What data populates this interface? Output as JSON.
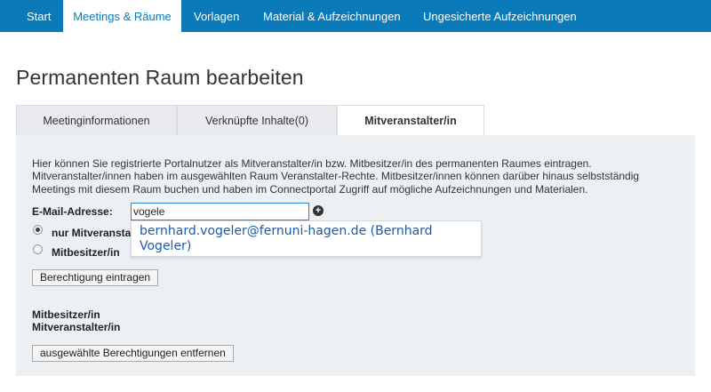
{
  "nav": {
    "items": [
      {
        "label": "Start",
        "active": false
      },
      {
        "label": "Meetings & Räume",
        "active": true
      },
      {
        "label": "Vorlagen",
        "active": false
      },
      {
        "label": "Material & Aufzeichnungen",
        "active": false
      },
      {
        "label": "Ungesicherte Aufzeichnungen",
        "active": false
      }
    ],
    "color": "#0a7ab8"
  },
  "page": {
    "title": "Permanenten Raum bearbeiten"
  },
  "tabs": [
    {
      "label": "Meetinginformationen",
      "active": false
    },
    {
      "label": "Verknüpfte Inhalte(0)",
      "active": false
    },
    {
      "label": "Mitveranstalter/in",
      "active": true
    }
  ],
  "content": {
    "description": "Hier können Sie registrierte Portalnutzer als Mitveranstalter/in bzw. Mitbesitzer/in des permanenten Raumes eintragen. Mitveranstalter/innen haben im ausgewählten Raum Veranstalter-Rechte. Mitbesitzer/innen können darüber hinaus selbstständig Meetings mit diesem Raum buchen und haben im Connectportal Zugriff auf mögliche Aufzeichnungen und Materialen.",
    "email_label": "E-Mail-Adresse:",
    "email_value": "vogele",
    "add_icon": "plus-circle-icon",
    "radio_options": [
      {
        "label": "nur Mitveranstalter/in",
        "checked": true
      },
      {
        "label": "Mitbesitzer/in",
        "checked": false
      }
    ],
    "suggestion": "bernhard.vogeler@fernuni-hagen.de (Bernhard Vogeler)",
    "submit_label": "Berechtigung eintragen",
    "owners_label": "Mitbesitzer/in",
    "cohosts_label": "Mitveranstalter/in",
    "remove_label": "ausgewählte Berechtigungen entfernen"
  }
}
